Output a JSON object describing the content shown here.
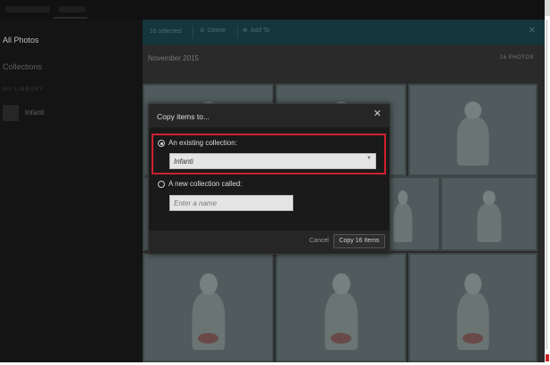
{
  "sidebar": {
    "all_photos": "All Photos",
    "collections": "Collections",
    "library_heading": "MY LIBRARY",
    "library_item": "Infanti"
  },
  "actionbar": {
    "selected": "16 selected",
    "delete_label": "Delete",
    "addto_label": "Add To"
  },
  "content": {
    "month": "November 2015",
    "count": "16 PHOTOS"
  },
  "dialog": {
    "title": "Copy items to...",
    "option_existing": "An existing collection:",
    "existing_selected": "Infanti",
    "option_new": "A new collection called:",
    "name_placeholder": "Enter a name",
    "cancel_label": "Cancel",
    "copy_label": "Copy 16 Items"
  },
  "colors": {
    "highlight_border": "#d0202f",
    "actionbar_bg": "#15363d"
  }
}
